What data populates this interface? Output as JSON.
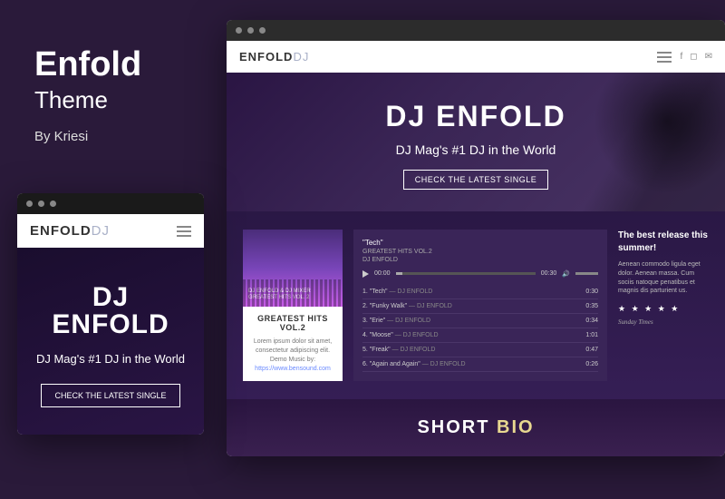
{
  "promo": {
    "title": "Enfold",
    "subtitle": "Theme",
    "byline": "By Kriesi"
  },
  "brand": {
    "part1": "ENFOLD",
    "part2": "DJ"
  },
  "hero": {
    "title": "DJ ENFOLD",
    "tagline": "DJ Mag's #1 DJ in the World",
    "button": "CHECK THE LATEST SINGLE"
  },
  "album": {
    "overlay_sub": "DJ ENFOLD & DJ MIXER",
    "overlay_title": "GREATEST HITS VOL. 2",
    "title": "GREATEST HITS VOL.2",
    "desc": "Lorem ipsum dolor sit amet, consectetur adipiscing elit. Demo Music by:",
    "link": "https://www.bensound.com"
  },
  "player": {
    "nowplaying": {
      "track": "\"Tech\"",
      "album": "GREATEST HITS VOL.2",
      "artist": "DJ ENFOLD"
    },
    "timeStart": "00:00",
    "timeEnd": "00:30",
    "playlist": [
      {
        "n": "1.",
        "title": "\"Tech\"",
        "artist": "— DJ ENFOLD",
        "dur": "0:30"
      },
      {
        "n": "2.",
        "title": "\"Funky Walk\"",
        "artist": "— DJ ENFOLD",
        "dur": "0:35"
      },
      {
        "n": "3.",
        "title": "\"Erie\"",
        "artist": "— DJ ENFOLD",
        "dur": "0:34"
      },
      {
        "n": "4.",
        "title": "\"Moose\"",
        "artist": "— DJ ENFOLD",
        "dur": "1:01"
      },
      {
        "n": "5.",
        "title": "\"Freak\"",
        "artist": "— DJ ENFOLD",
        "dur": "0:47"
      },
      {
        "n": "6.",
        "title": "\"Again and Again\"",
        "artist": "— DJ ENFOLD",
        "dur": "0:26"
      }
    ]
  },
  "review": {
    "heading": "The best release this summer!",
    "body": "Aenean commodo ligula eget dolor. Aenean massa. Cum sociis natoque penatibus et magnis dis parturient us.",
    "stars": "★ ★ ★ ★ ★",
    "source": "Sunday Times"
  },
  "bio": {
    "label1": "SHORT ",
    "label2": "BIO"
  }
}
